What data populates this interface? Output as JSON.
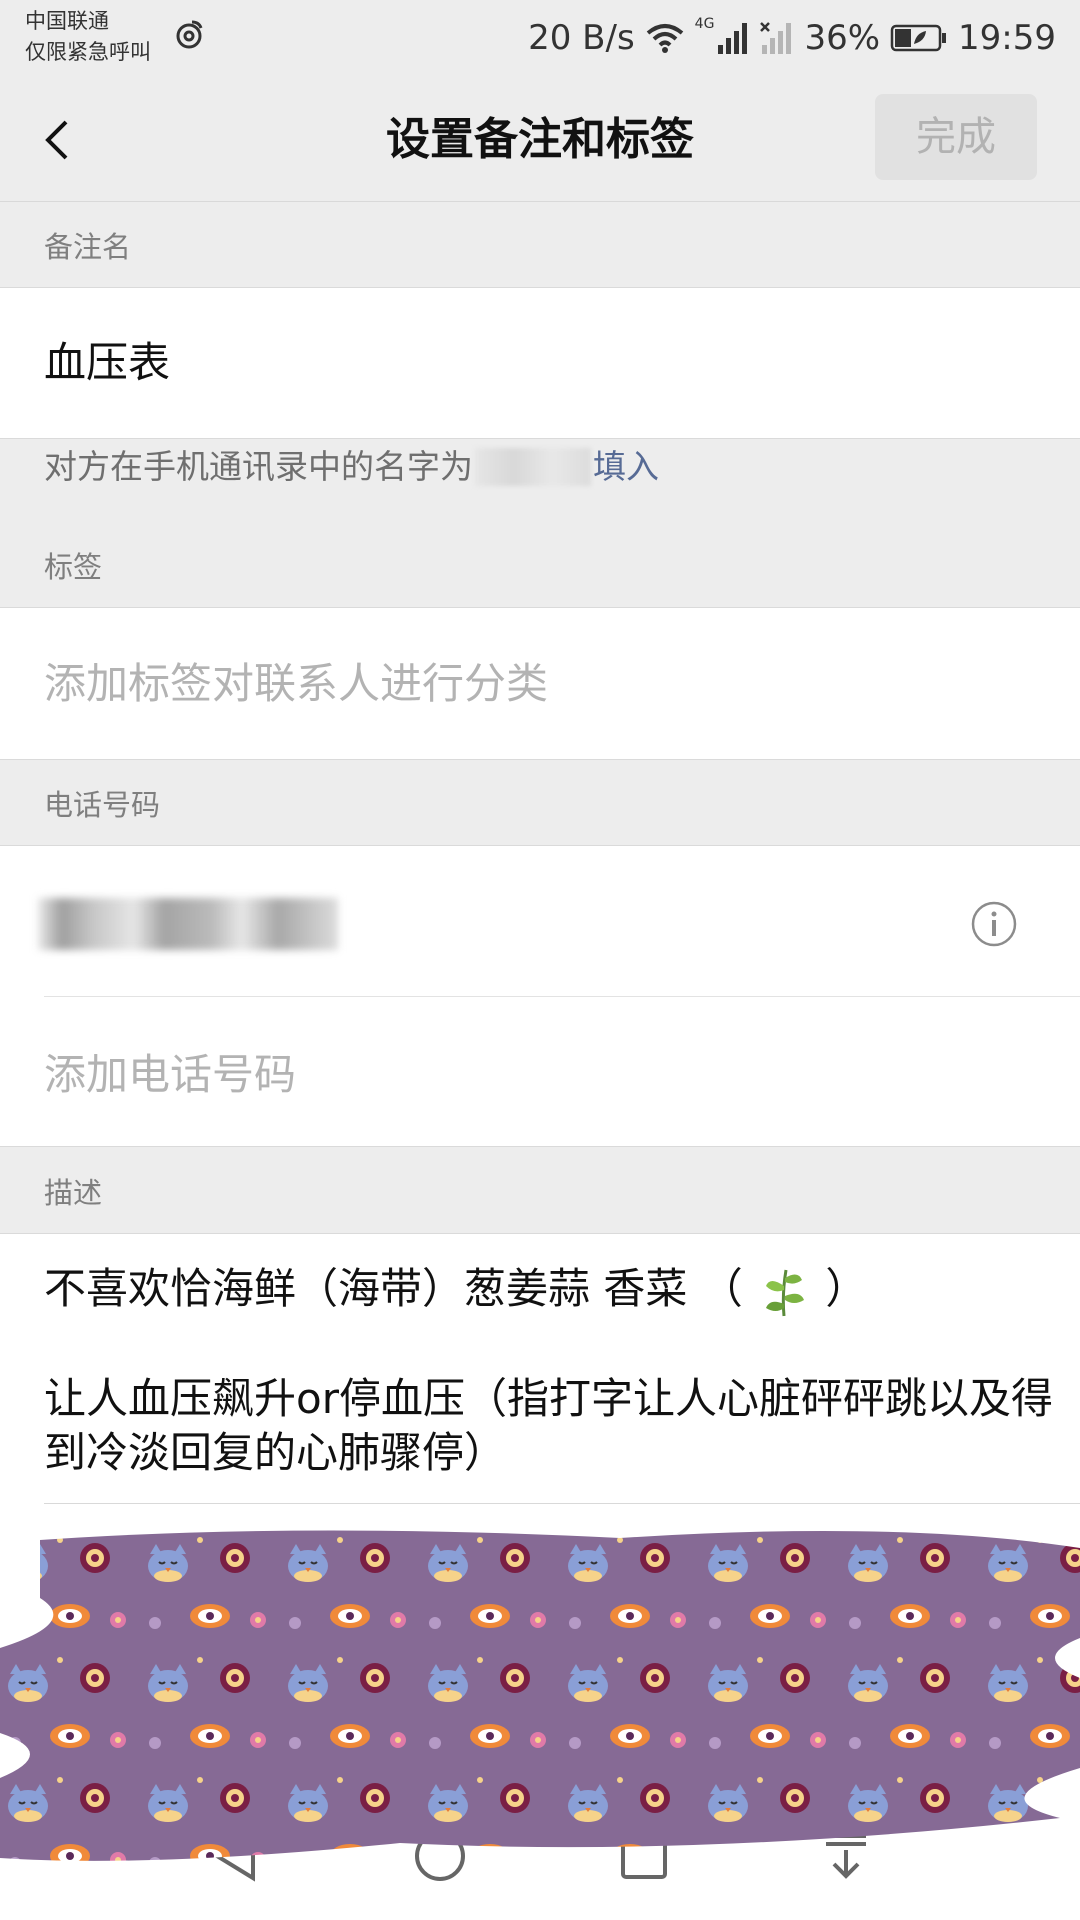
{
  "status_bar": {
    "carrier": "中国联通",
    "emergency": "仅限紧急呼叫",
    "net_speed": "20 B/s",
    "network": "4G",
    "battery": "36%",
    "time": "19:59"
  },
  "nav": {
    "title": "设置备注和标签",
    "done_label": "完成"
  },
  "remark": {
    "section_label": "备注名",
    "value": "血压表",
    "hint_prefix": "对方在手机通讯录中的名字为",
    "hint_action": "填入"
  },
  "tags": {
    "section_label": "标签",
    "placeholder": "添加标签对联系人进行分类"
  },
  "phone": {
    "section_label": "电话号码",
    "add_placeholder": "添加电话号码"
  },
  "description": {
    "section_label": "描述",
    "line1_text": "不喜欢恰海鲜（海带）葱姜蒜 香菜 （",
    "line1_end": "）",
    "line2": "让人血压飙升or停血压（指打字让人心脏砰砰跳以及得到冷淡回复的心肺骤停）"
  },
  "colors": {
    "background": "#ededed",
    "link": "#576b95",
    "pattern": "#866a95"
  }
}
